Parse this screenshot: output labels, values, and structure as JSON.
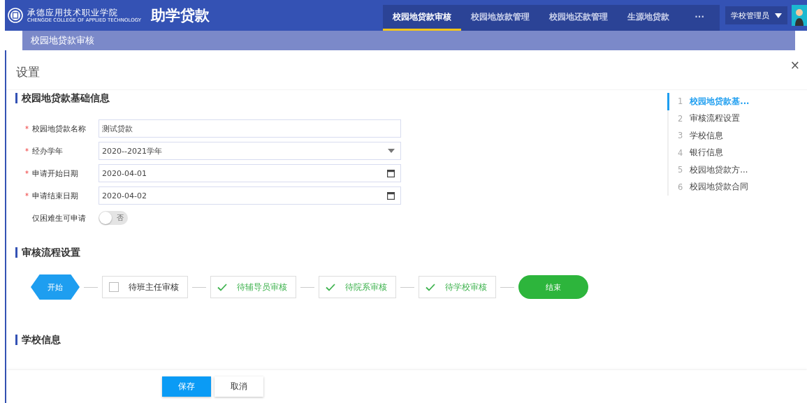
{
  "header": {
    "school_name": "承德应用技术职业学院",
    "school_name_en": "CHENGDE COLLEGE OF APPLIED TECHNOLOGY",
    "app_title": "助学贷款",
    "nav": [
      {
        "label": "校园地贷款审核",
        "selected": true
      },
      {
        "label": "校园地放款管理",
        "selected": false
      },
      {
        "label": "校园地还款管理",
        "selected": false
      },
      {
        "label": "生源地贷款",
        "selected": false
      }
    ],
    "more": "···",
    "user": "学校管理员"
  },
  "page_title": "校园地贷款审核",
  "drawer": {
    "title": "设置",
    "close": "×",
    "sections": [
      {
        "title": "校园地贷款基础信息",
        "kind": "form",
        "fields": [
          {
            "label": "校园地贷款名称",
            "mark": "*",
            "kind": "text",
            "value": "测试贷款"
          },
          {
            "label": "经办学年",
            "mark": "*",
            "kind": "select",
            "value": "2020--2021学年"
          },
          {
            "label": "申请开始日期",
            "mark": "*",
            "kind": "date",
            "value": "2020-04-01"
          },
          {
            "label": "申请结束日期",
            "mark": "*",
            "kind": "date",
            "value": "2020-04-02"
          },
          {
            "label": "仅困难生可申请",
            "kind": "switch",
            "on": false,
            "value": "否"
          }
        ]
      },
      {
        "title": "审核流程设置",
        "kind": "flow",
        "steps": [
          {
            "kind": "start",
            "label": "开始"
          },
          {
            "kind": "step",
            "label": "待班主任审核",
            "checked": false
          },
          {
            "kind": "step",
            "label": "待辅导员审核",
            "checked": true
          },
          {
            "kind": "step",
            "label": "待院系审核",
            "checked": true
          },
          {
            "kind": "step",
            "label": "待学校审核",
            "checked": true
          },
          {
            "kind": "end",
            "label": "结束"
          }
        ]
      },
      {
        "title": "学校信息",
        "kind": "heading"
      }
    ],
    "anchors": [
      {
        "number": "1",
        "label": "校园地贷款基...",
        "selected": true
      },
      {
        "number": "2",
        "label": "审核流程设置",
        "selected": false
      },
      {
        "number": "3",
        "label": "学校信息",
        "selected": false
      },
      {
        "number": "4",
        "label": "银行信息",
        "selected": false
      },
      {
        "number": "5",
        "label": "校园地贷款方...",
        "selected": false
      },
      {
        "number": "6",
        "label": "校园地贷款合同",
        "selected": false
      }
    ],
    "buttons": [
      {
        "label": "保存",
        "kind": "primary"
      },
      {
        "label": "取消",
        "kind": "default"
      }
    ]
  }
}
